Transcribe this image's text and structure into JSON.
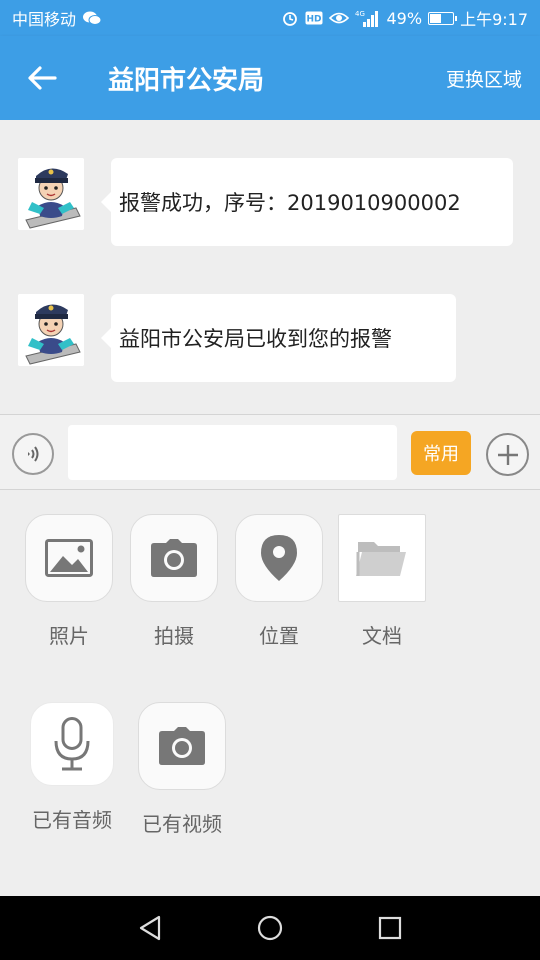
{
  "status_bar": {
    "carrier": "中国移动",
    "battery": "49%",
    "battery_level": 0.49,
    "time": "上午9:17",
    "network": "4G"
  },
  "header": {
    "title": "益阳市公安局",
    "switch_area_label": "更换区域"
  },
  "messages": [
    {
      "text": "报警成功，序号：2019010900002"
    },
    {
      "text": "益阳市公安局已收到您的报警"
    }
  ],
  "input_bar": {
    "placeholder": "",
    "value": "",
    "common_label": "常用"
  },
  "tools": [
    {
      "label": "照片",
      "icon": "image-icon"
    },
    {
      "label": "拍摄",
      "icon": "camera-icon"
    },
    {
      "label": "位置",
      "icon": "location-pin-icon"
    },
    {
      "label": "文档",
      "icon": "folder-icon"
    },
    {
      "label": "已有音频",
      "icon": "microphone-icon"
    },
    {
      "label": "已有视频",
      "icon": "video-camera-icon"
    }
  ],
  "colors": {
    "primary": "#3d9ee6",
    "accent": "#f5a623",
    "background": "#eeeeee"
  }
}
